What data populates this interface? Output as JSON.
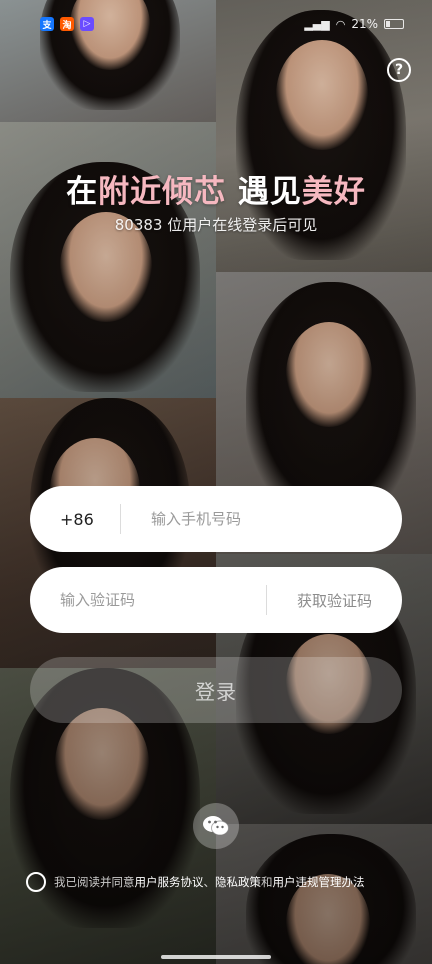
{
  "status_bar": {
    "time": "",
    "app_icons": [
      "支",
      "淘",
      "▷"
    ],
    "battery": "21%"
  },
  "header": {
    "help_icon": "?",
    "headline_part1": "在",
    "headline_accent1": "附近倾芯",
    "headline_part2": " 遇见",
    "headline_accent2": "美好",
    "subline": "80383 位用户在线登录后可见"
  },
  "form": {
    "country_code": "+86",
    "phone_placeholder": "输入手机号码",
    "code_placeholder": "输入验证码",
    "get_code_label": "获取验证码",
    "login_label": "登录"
  },
  "wechat": {
    "icon": "wechat-icon"
  },
  "agreement": {
    "prefix": "我已阅读并同意",
    "link1": "用户服务协议",
    "sep1": "、",
    "link2": "隐私政策",
    "sep2": "和",
    "link3": "用户违规管理办法"
  },
  "colors": {
    "accent": "#f6b8c0",
    "field_bg": "#ffffff",
    "placeholder": "#9a9a9a"
  }
}
